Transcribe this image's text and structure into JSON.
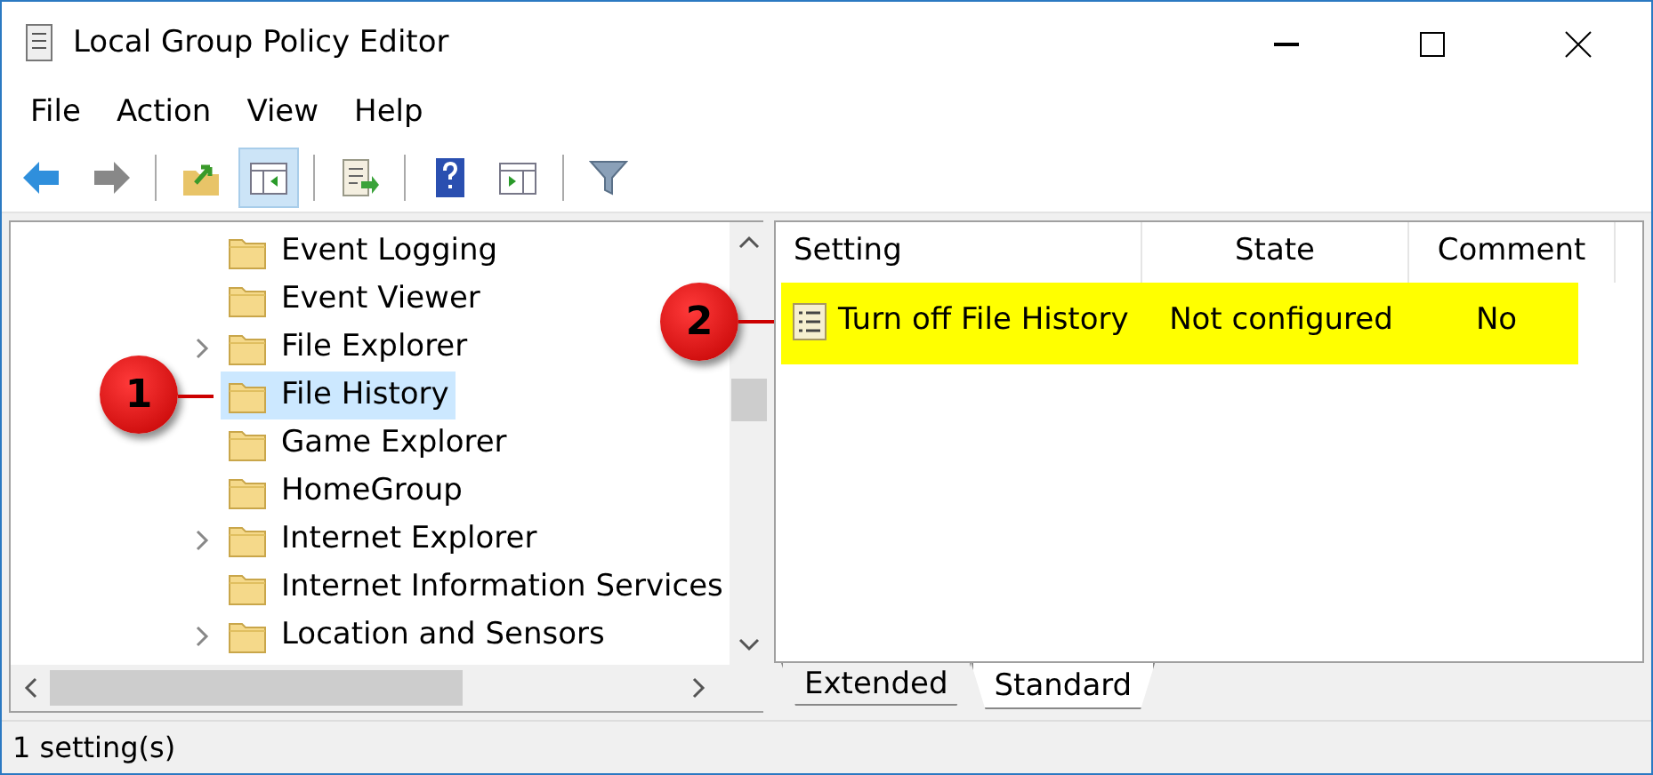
{
  "window": {
    "title": "Local Group Policy Editor"
  },
  "menu": [
    "File",
    "Action",
    "View",
    "Help"
  ],
  "toolbar": [
    {
      "kind": "back",
      "pressed": false
    },
    {
      "kind": "forward",
      "pressed": false
    },
    {
      "kind": "sep"
    },
    {
      "kind": "up-folder",
      "pressed": false
    },
    {
      "kind": "tree-toggle",
      "pressed": true
    },
    {
      "kind": "sep"
    },
    {
      "kind": "export",
      "pressed": false
    },
    {
      "kind": "sep"
    },
    {
      "kind": "help",
      "pressed": false
    },
    {
      "kind": "pane-toggle",
      "pressed": false
    },
    {
      "kind": "sep"
    },
    {
      "kind": "filter",
      "pressed": false
    }
  ],
  "tree": {
    "items": [
      {
        "label": "Event Logging",
        "expandable": false,
        "selected": false
      },
      {
        "label": "Event Viewer",
        "expandable": false,
        "selected": false
      },
      {
        "label": "File Explorer",
        "expandable": true,
        "selected": false
      },
      {
        "label": "File History",
        "expandable": false,
        "selected": true,
        "callout": "1"
      },
      {
        "label": "Game Explorer",
        "expandable": false,
        "selected": false
      },
      {
        "label": "HomeGroup",
        "expandable": false,
        "selected": false
      },
      {
        "label": "Internet Explorer",
        "expandable": true,
        "selected": false
      },
      {
        "label": "Internet Information Services",
        "expandable": false,
        "selected": false
      },
      {
        "label": "Location and Sensors",
        "expandable": true,
        "selected": false
      }
    ]
  },
  "settings": {
    "columns": [
      "Setting",
      "State",
      "Comment"
    ],
    "rows": [
      {
        "cells": [
          "Turn off File History",
          "Not configured",
          "No"
        ],
        "highlighted": true,
        "callout": "2"
      }
    ],
    "tabs": [
      {
        "label": "Extended",
        "selected": false
      },
      {
        "label": "Standard",
        "selected": true
      }
    ]
  },
  "status_bar": "1 setting(s)"
}
